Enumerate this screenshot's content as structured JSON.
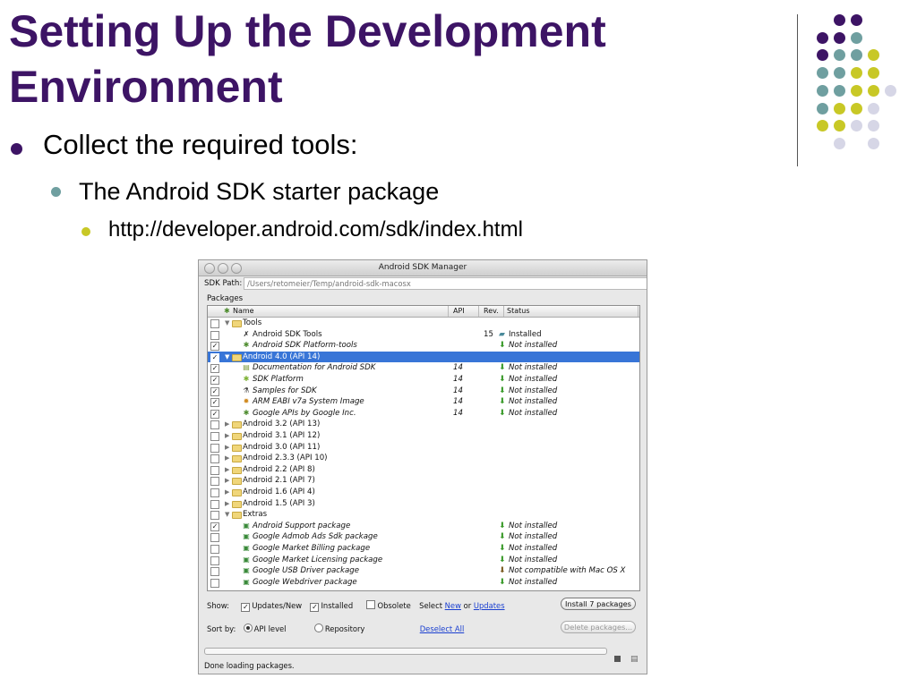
{
  "slide": {
    "title_line1": "Setting Up the Development",
    "title_line2": "Environment",
    "bullet1": "Collect the required tools:",
    "bullet2": "The Android SDK starter package",
    "bullet3": "http://developer.android.com/sdk/index.html"
  },
  "colors": {
    "purple": "#3d1465",
    "teal": "#6f9fa0",
    "olive": "#c8c826",
    "lavender": "#d6d6e6"
  },
  "window": {
    "title": "Android SDK Manager",
    "sdk_path_label": "SDK Path:",
    "sdk_path_value": "/Users/retomeier/Temp/android-sdk-macosx",
    "packages_label": "Packages",
    "columns": {
      "name": "Name",
      "api": "API",
      "rev": "Rev.",
      "status": "Status"
    },
    "rows": [
      {
        "level": 0,
        "expander": "▼",
        "icon": "folder-icon",
        "name": "Tools",
        "api": "",
        "rev": "",
        "status": "",
        "checked": false
      },
      {
        "level": 1,
        "expander": "",
        "icon": "tools-icon",
        "name": "Android SDK Tools",
        "api": "",
        "rev": "15",
        "status": "Installed",
        "checked": false
      },
      {
        "level": 1,
        "expander": "",
        "icon": "platform-tools-icon",
        "name": "Android SDK Platform-tools",
        "api": "",
        "rev": "",
        "status": "Not installed",
        "checked": true,
        "italic": true
      },
      {
        "level": 0,
        "expander": "▼",
        "icon": "folder-icon",
        "name": "Android 4.0 (API 14)",
        "api": "",
        "rev": "",
        "status": "",
        "checked": true,
        "selected": true
      },
      {
        "level": 1,
        "expander": "",
        "icon": "doc-icon",
        "name": "Documentation for Android SDK",
        "api": "14",
        "rev": "",
        "status": "Not installed",
        "checked": true,
        "italic": true
      },
      {
        "level": 1,
        "expander": "",
        "icon": "android-icon",
        "name": "SDK Platform",
        "api": "14",
        "rev": "",
        "status": "Not installed",
        "checked": true,
        "italic": true
      },
      {
        "level": 1,
        "expander": "",
        "icon": "flask-icon",
        "name": "Samples for SDK",
        "api": "14",
        "rev": "",
        "status": "Not installed",
        "checked": true,
        "italic": true
      },
      {
        "level": 1,
        "expander": "",
        "icon": "chip-icon",
        "name": "ARM EABI v7a System Image",
        "api": "14",
        "rev": "",
        "status": "Not installed",
        "checked": true,
        "italic": true
      },
      {
        "level": 1,
        "expander": "",
        "icon": "addon-icon",
        "name": "Google APIs by Google Inc.",
        "api": "14",
        "rev": "",
        "status": "Not installed",
        "checked": true,
        "italic": true
      },
      {
        "level": 0,
        "expander": "▶",
        "icon": "folder-icon",
        "name": "Android 3.2 (API 13)",
        "api": "",
        "rev": "",
        "status": "",
        "checked": false
      },
      {
        "level": 0,
        "expander": "▶",
        "icon": "folder-icon",
        "name": "Android 3.1 (API 12)",
        "api": "",
        "rev": "",
        "status": "",
        "checked": false
      },
      {
        "level": 0,
        "expander": "▶",
        "icon": "folder-icon",
        "name": "Android 3.0 (API 11)",
        "api": "",
        "rev": "",
        "status": "",
        "checked": false
      },
      {
        "level": 0,
        "expander": "▶",
        "icon": "folder-icon",
        "name": "Android 2.3.3 (API 10)",
        "api": "",
        "rev": "",
        "status": "",
        "checked": false
      },
      {
        "level": 0,
        "expander": "▶",
        "icon": "folder-icon",
        "name": "Android 2.2 (API 8)",
        "api": "",
        "rev": "",
        "status": "",
        "checked": false
      },
      {
        "level": 0,
        "expander": "▶",
        "icon": "folder-icon",
        "name": "Android 2.1 (API 7)",
        "api": "",
        "rev": "",
        "status": "",
        "checked": false
      },
      {
        "level": 0,
        "expander": "▶",
        "icon": "folder-icon",
        "name": "Android 1.6 (API 4)",
        "api": "",
        "rev": "",
        "status": "",
        "checked": false
      },
      {
        "level": 0,
        "expander": "▶",
        "icon": "folder-icon",
        "name": "Android 1.5 (API 3)",
        "api": "",
        "rev": "",
        "status": "",
        "checked": false
      },
      {
        "level": 0,
        "expander": "▼",
        "icon": "folder-icon",
        "name": "Extras",
        "api": "",
        "rev": "",
        "status": "",
        "checked": false
      },
      {
        "level": 1,
        "expander": "",
        "icon": "package-icon",
        "name": "Android Support package",
        "api": "",
        "rev": "",
        "status": "Not installed",
        "checked": true,
        "italic": true
      },
      {
        "level": 1,
        "expander": "",
        "icon": "package-icon",
        "name": "Google Admob Ads Sdk package",
        "api": "",
        "rev": "",
        "status": "Not installed",
        "checked": false,
        "italic": true
      },
      {
        "level": 1,
        "expander": "",
        "icon": "package-icon",
        "name": "Google Market Billing package",
        "api": "",
        "rev": "",
        "status": "Not installed",
        "checked": false,
        "italic": true
      },
      {
        "level": 1,
        "expander": "",
        "icon": "package-icon",
        "name": "Google Market Licensing package",
        "api": "",
        "rev": "",
        "status": "Not installed",
        "checked": false,
        "italic": true
      },
      {
        "level": 1,
        "expander": "",
        "icon": "package-icon",
        "name": "Google USB Driver package",
        "api": "",
        "rev": "",
        "status": "Not compatible with Mac OS X",
        "checked": false,
        "italic": true
      },
      {
        "level": 1,
        "expander": "",
        "icon": "package-icon",
        "name": "Google Webdriver package",
        "api": "",
        "rev": "",
        "status": "Not installed",
        "checked": false,
        "italic": true
      }
    ],
    "show_label": "Show:",
    "updates_new": "Updates/New",
    "installed": "Installed",
    "obsolete": "Obsolete",
    "select_prefix": "Select",
    "select_new": "New",
    "select_or": "or",
    "select_updates": "Updates",
    "install_button": "Install 7 packages",
    "sort_label": "Sort by:",
    "api_level": "API level",
    "repository": "Repository",
    "deselect_all": "Deselect All",
    "delete_button": "Delete packages...",
    "status_text": "Done loading packages."
  }
}
